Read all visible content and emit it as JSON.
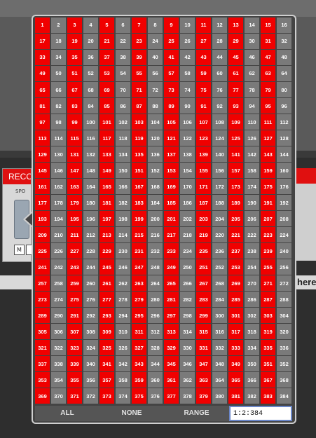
{
  "background": {
    "panel_title": "RECO",
    "panel_sub": "SPO",
    "panel_btn_m": "M",
    "panel_btn_2": "",
    "here_text": "here"
  },
  "channel_grid": {
    "total": 384,
    "columns": 16,
    "selected_color": "#f00000",
    "unselected_color": "#7a7a7a",
    "selected": [
      1,
      3,
      5,
      7,
      9,
      11,
      13,
      15,
      17,
      19,
      21,
      23,
      25,
      27,
      29,
      31,
      33,
      35,
      37,
      39,
      41,
      43,
      45,
      47,
      49,
      51,
      53,
      55,
      57,
      59,
      61,
      63,
      65,
      67,
      69,
      71,
      73,
      75,
      77,
      79,
      81,
      83,
      85,
      87,
      89,
      91,
      93,
      95,
      97,
      99,
      101,
      103,
      105,
      107,
      109,
      111,
      113,
      115,
      117,
      119,
      121,
      123,
      125,
      127,
      129,
      131,
      133,
      135,
      137,
      139,
      141,
      143,
      145,
      147,
      149,
      151,
      153,
      155,
      157,
      159,
      161,
      163,
      165,
      167,
      169,
      171,
      173,
      175,
      177,
      179,
      181,
      183,
      185,
      187,
      189,
      191,
      193,
      195,
      197,
      199,
      201,
      203,
      205,
      207,
      209,
      211,
      213,
      215,
      217,
      219,
      221,
      223,
      225,
      227,
      229,
      231,
      233,
      235,
      237,
      239,
      241,
      243,
      245,
      247,
      249,
      251,
      253,
      255,
      257,
      259,
      261,
      263,
      265,
      267,
      269,
      271,
      273,
      275,
      277,
      279,
      281,
      283,
      285,
      287,
      289,
      291,
      293,
      295,
      297,
      299,
      301,
      303,
      305,
      307,
      309,
      311,
      313,
      315,
      317,
      319,
      321,
      323,
      325,
      327,
      329,
      331,
      333,
      335,
      337,
      339,
      341,
      343,
      345,
      347,
      349,
      351,
      353,
      355,
      357,
      359,
      361,
      363,
      365,
      367,
      369,
      371,
      373,
      375,
      377,
      379,
      381,
      383
    ]
  },
  "footer": {
    "all_label": "ALL",
    "none_label": "NONE",
    "range_label": "RANGE",
    "range_value": "1:2:384"
  }
}
